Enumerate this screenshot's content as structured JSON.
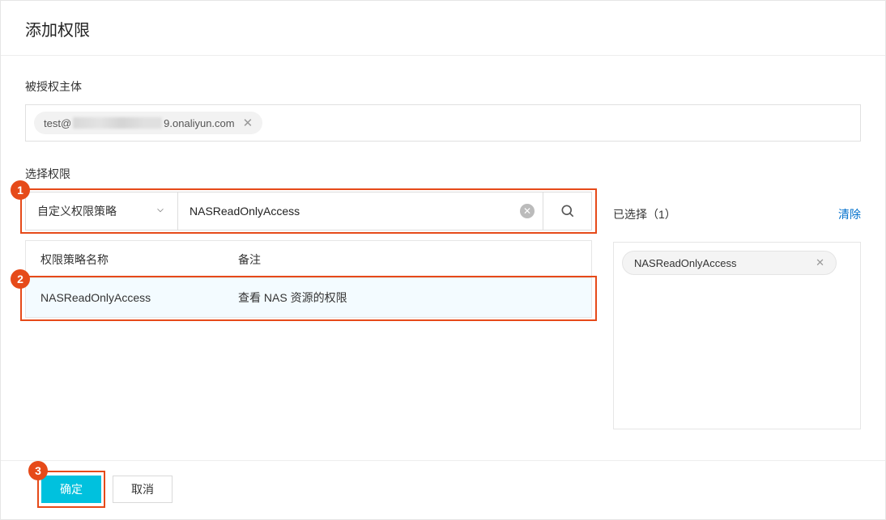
{
  "header": {
    "title": "添加权限"
  },
  "principal": {
    "label": "被授权主体",
    "chip_prefix": "test@",
    "chip_suffix": "9.onaliyun.com"
  },
  "permission": {
    "label": "选择权限",
    "dropdown_value": "自定义权限策略",
    "search_value": "NASReadOnlyAccess",
    "table": {
      "col1": "权限策略名称",
      "col2": "备注",
      "rows": [
        {
          "name": "NASReadOnlyAccess",
          "note": "查看 NAS 资源的权限"
        }
      ]
    }
  },
  "selected": {
    "header": "已选择（1）",
    "clear": "清除",
    "items": [
      {
        "name": "NASReadOnlyAccess"
      }
    ]
  },
  "footer": {
    "ok": "确定",
    "cancel": "取消"
  },
  "annotations": {
    "m1": "1",
    "m2": "2",
    "m3": "3"
  }
}
